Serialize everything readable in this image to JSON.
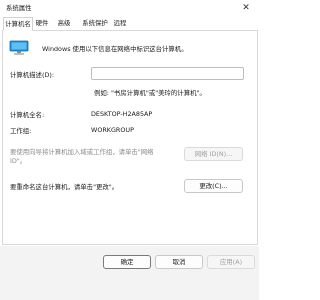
{
  "window": {
    "title": "系统属性",
    "close": "✕"
  },
  "tabs": [
    {
      "label": "计算机名"
    },
    {
      "label": "硬件"
    },
    {
      "label": "高级"
    },
    {
      "label": "系统保护"
    },
    {
      "label": "远程"
    }
  ],
  "computer_name_tab": {
    "intro_text": "Windows 使用以下信息在网络中标识这台计算机。",
    "description_label": "计算机描述(D):",
    "description_value": "",
    "description_example": "例如: \"书房计算机\"或\"美玲的计算机\"。",
    "full_name_label": "计算机全名:",
    "full_name_value": "DESKTOP-H2A85AP",
    "workgroup_label": "工作组:",
    "workgroup_value": "WORKGROUP",
    "network_id_text_line1": "要使用向导将计算机加入域或工作组，请单击\"网络",
    "network_id_text_line2": "ID\"。",
    "network_id_button": "网络 ID(N)...",
    "rename_text": "要重命名这台计算机，请单击\"更改\"。",
    "change_button": "更改(C)..."
  },
  "footer": {
    "ok": "确定",
    "cancel": "取消",
    "apply": "应用(A)"
  },
  "colors": {
    "footer_bg": "#f3f3f3",
    "border": "#d9d9d9",
    "monitor_blue": "#1e90d6"
  }
}
